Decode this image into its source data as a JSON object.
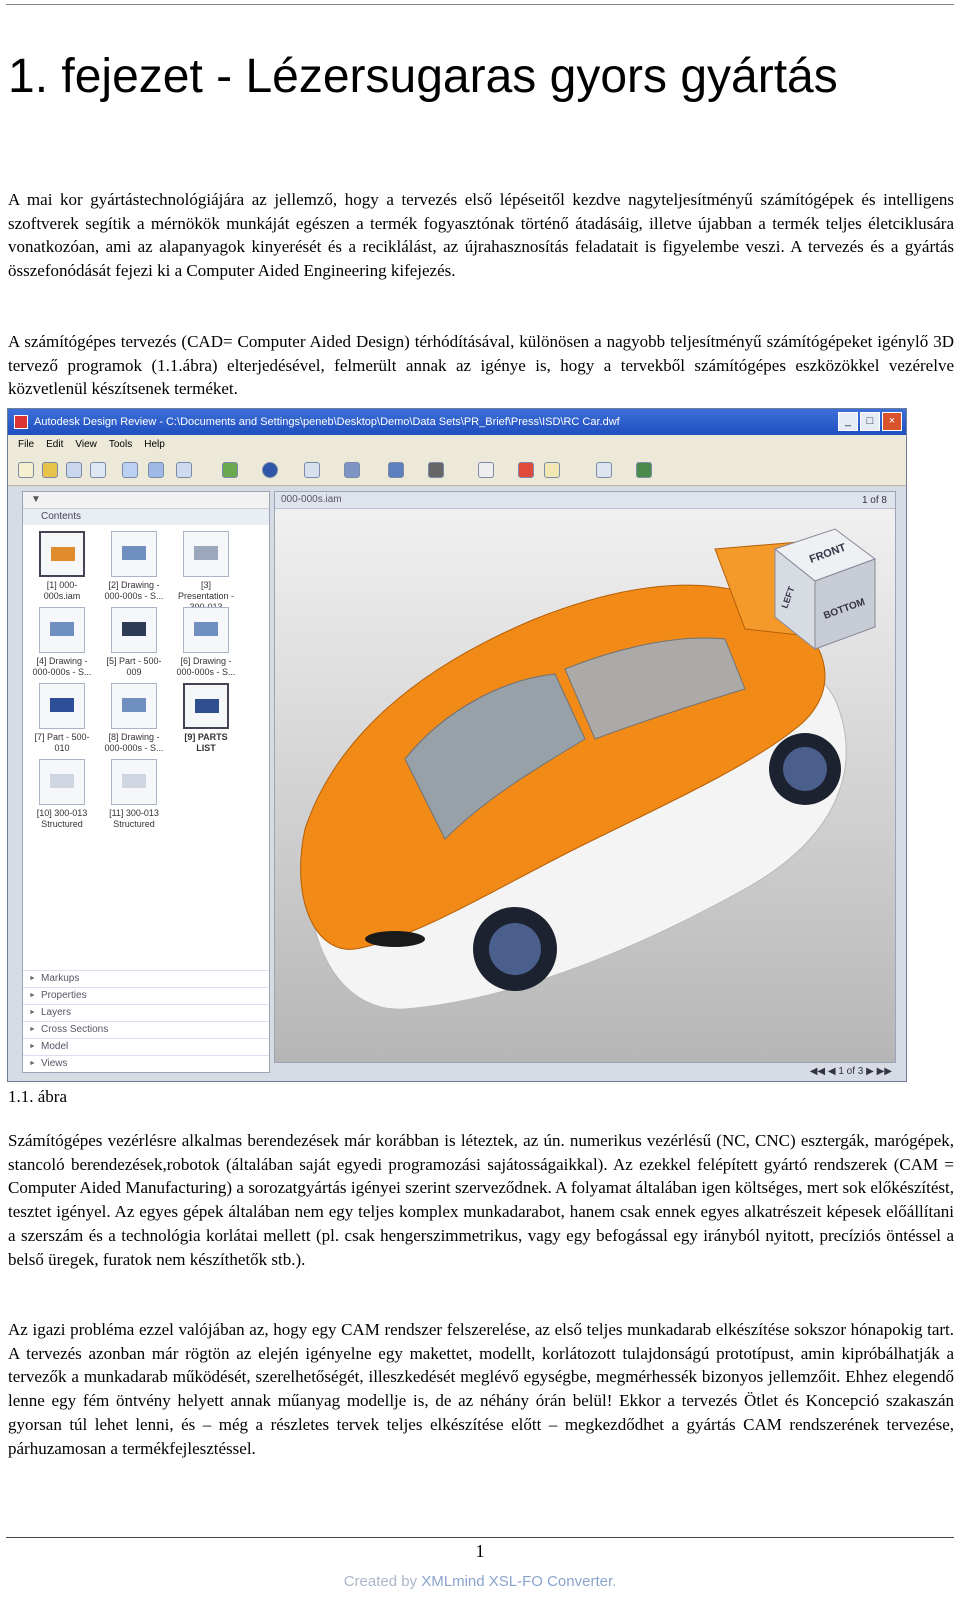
{
  "heading": "1. fejezet - Lézersugaras gyors gyártás",
  "paragraphs": [
    "A mai kor gyártástechnológiájára az jellemző, hogy a tervezés első lépéseitől kezdve nagyteljesítményű számítógépek és intelligens szoftverek segítik a mérnökök munkáját egészen a termék fogyasztónak történő átadásáig, illetve újabban a termék teljes életciklusára vonatkozóan, ami az alapanyagok kinyerését és a reciklálást, az újrahasznosítás feladatait is figyelembe veszi. A tervezés és a gyártás összefonódását fejezi ki a Computer Aided Engineering kifejezés.",
    "A számítógépes tervezés (CAD= Computer Aided Design) térhódításával, különösen a nagyobb teljesítményű számítógépeket igénylő 3D tervező programok (1.1.ábra) elterjedésével, felmerült annak az igénye is, hogy a tervekből számítógépes eszközökkel vezérelve közvetlenül készítsenek terméket.",
    "Számítógépes vezérlésre alkalmas berendezések már korábban is léteztek, az ún. numerikus vezérlésű (NC, CNC) esztergák, marógépek, stancoló berendezések,robotok (általában saját egyedi programozási sajátosságaikkal). Az ezekkel felépített gyártó rendszerek (CAM = Computer Aided Manufacturing) a sorozatgyártás igényei szerint szerveződnek. A folyamat általában igen költséges, mert sok előkészítést, tesztet igényel. Az egyes gépek általában nem egy teljes komplex munkadarabot, hanem csak ennek egyes alkatrészeit képesek előállítani a szerszám és a technológia korlátai mellett (pl. csak hengerszimmetrikus, vagy egy befogással egy irányból nyitott, precíziós öntéssel a belső üregek, furatok nem készíthetők stb.).",
    "Az igazi probléma ezzel valójában az, hogy egy CAM rendszer felszerelése, az első teljes munkadarab elkészítése sokszor hónapokig tart. A tervezés azonban már rögtön az elején igényelne egy makettet, modellt, korlátozott tulajdonságú prototípust, amin kipróbálhatják a tervezők a munkadarab működését, szerelhetőségét, illeszkedését meglévő egységbe, megmérhessék bizonyos jellemzőit. Ehhez elegendő lenne egy fém öntvény helyett annak műanyag modellje is, de az néhány órán belül! Ekkor a tervezés Ötlet és Koncepció szakaszán gyorsan túl lehet lenni, és – még a részletes tervek teljes elkészítése előtt – megkezdődhet a gyártás CAM rendszerének tervezése, párhuzamosan a termékfejlesztéssel."
  ],
  "figure": {
    "window_title": "Autodesk Design Review - C:\\Documents and Settings\\peneb\\Desktop\\Demo\\Data Sets\\PR_Brief\\Press\\ISD\\RC Car.dwf",
    "menu": [
      "File",
      "Edit",
      "View",
      "Tools",
      "Help"
    ],
    "contents_label": "Contents",
    "viewport_tab": "000-000s.iam",
    "page_nav": "1 of 8",
    "thumbnails": [
      "[1] 000-000s.iam",
      "[2] Drawing - 000-000s - S...",
      "[3] Presentation - 300-013",
      "[4] Drawing - 000-000s - S...",
      "[5] Part - 500-009",
      "[6] Drawing - 000-000s - S...",
      "[7] Part - 500-010",
      "[8] Drawing - 000-000s - S...",
      "[9] PARTS LIST",
      "[10] 300-013 Structured",
      "[11] 300-013 Structured"
    ],
    "panels": [
      "Markups",
      "Properties",
      "Layers",
      "Cross Sections",
      "Model",
      "Views"
    ],
    "viewcube": [
      "FRONT",
      "BOTTOM",
      "LEFT"
    ],
    "status": "1 of 3"
  },
  "caption": "1.1. ábra",
  "page_number": "1",
  "credit": {
    "prefix": "Created by ",
    "brand": "XMLmind XSL-FO Converter",
    "suffix": "."
  }
}
